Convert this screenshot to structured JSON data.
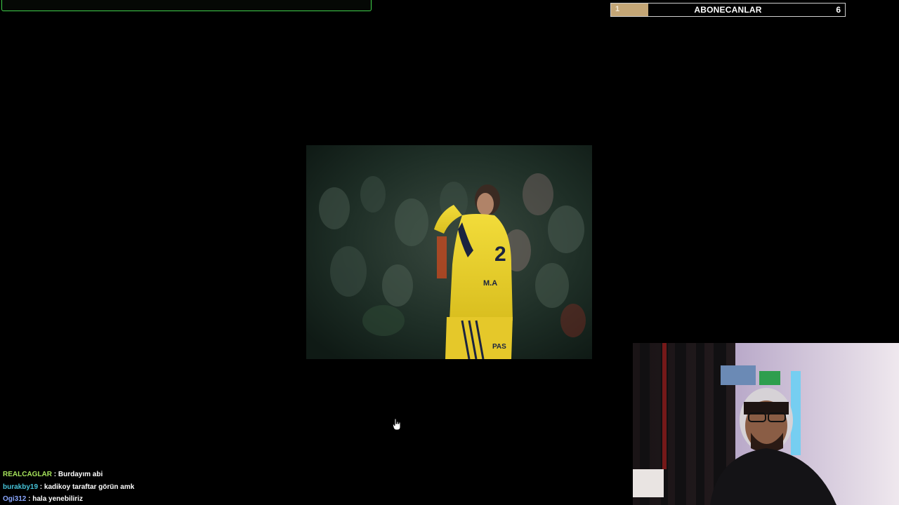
{
  "goal_bar": {
    "progress": 0.0,
    "color": "#3fd24a"
  },
  "subscriber_goal": {
    "start_value": "1",
    "label": "ABONECANLAR",
    "end_value": "6",
    "progress": 0.16,
    "fill_color": "#c4a676"
  },
  "media": {
    "icon": "football-player-video"
  },
  "webcam": {
    "icon": "streamer-webcam"
  },
  "chat": [
    {
      "user": "REALCAGLAR",
      "message": "Burdayım abi",
      "user_color": "#a6e35b"
    },
    {
      "user": "burakby19",
      "message": "kadikoy taraftar görün amk",
      "user_color": "#46c3d8"
    },
    {
      "user": "Ogi312",
      "message": "hala yenebiliriz",
      "user_color": "#8aa7ff"
    }
  ],
  "chat_separator": " : ",
  "cursor": {
    "icon": "hand-pointer-icon"
  }
}
